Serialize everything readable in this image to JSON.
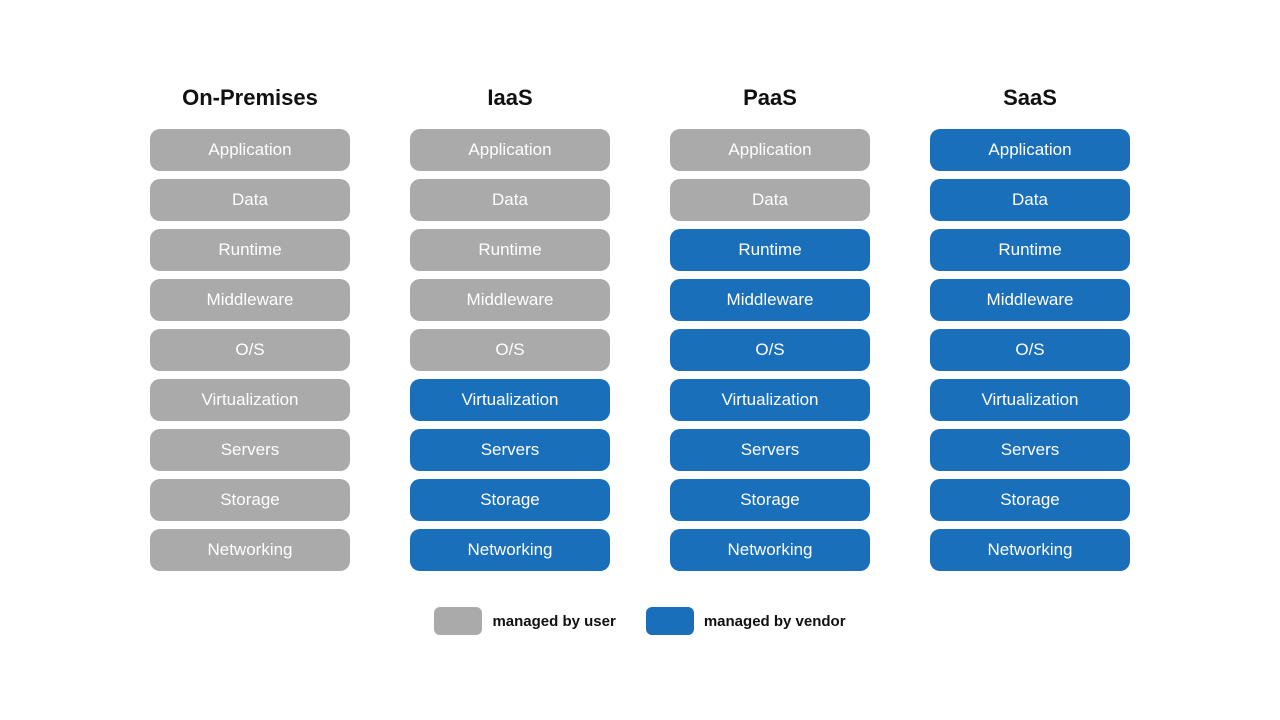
{
  "columns": [
    {
      "id": "on-premises",
      "header": "On-Premises",
      "pills": [
        {
          "label": "Application",
          "type": "user"
        },
        {
          "label": "Data",
          "type": "user"
        },
        {
          "label": "Runtime",
          "type": "user"
        },
        {
          "label": "Middleware",
          "type": "user"
        },
        {
          "label": "O/S",
          "type": "user"
        },
        {
          "label": "Virtualization",
          "type": "user"
        },
        {
          "label": "Servers",
          "type": "user"
        },
        {
          "label": "Storage",
          "type": "user"
        },
        {
          "label": "Networking",
          "type": "user"
        }
      ]
    },
    {
      "id": "iaas",
      "header": "IaaS",
      "pills": [
        {
          "label": "Application",
          "type": "user"
        },
        {
          "label": "Data",
          "type": "user"
        },
        {
          "label": "Runtime",
          "type": "user"
        },
        {
          "label": "Middleware",
          "type": "user"
        },
        {
          "label": "O/S",
          "type": "user"
        },
        {
          "label": "Virtualization",
          "type": "vendor"
        },
        {
          "label": "Servers",
          "type": "vendor"
        },
        {
          "label": "Storage",
          "type": "vendor"
        },
        {
          "label": "Networking",
          "type": "vendor"
        }
      ]
    },
    {
      "id": "paas",
      "header": "PaaS",
      "pills": [
        {
          "label": "Application",
          "type": "user"
        },
        {
          "label": "Data",
          "type": "user"
        },
        {
          "label": "Runtime",
          "type": "vendor"
        },
        {
          "label": "Middleware",
          "type": "vendor"
        },
        {
          "label": "O/S",
          "type": "vendor"
        },
        {
          "label": "Virtualization",
          "type": "vendor"
        },
        {
          "label": "Servers",
          "type": "vendor"
        },
        {
          "label": "Storage",
          "type": "vendor"
        },
        {
          "label": "Networking",
          "type": "vendor"
        }
      ]
    },
    {
      "id": "saas",
      "header": "SaaS",
      "pills": [
        {
          "label": "Application",
          "type": "vendor"
        },
        {
          "label": "Data",
          "type": "vendor"
        },
        {
          "label": "Runtime",
          "type": "vendor"
        },
        {
          "label": "Middleware",
          "type": "vendor"
        },
        {
          "label": "O/S",
          "type": "vendor"
        },
        {
          "label": "Virtualization",
          "type": "vendor"
        },
        {
          "label": "Servers",
          "type": "vendor"
        },
        {
          "label": "Storage",
          "type": "vendor"
        },
        {
          "label": "Networking",
          "type": "vendor"
        }
      ]
    }
  ],
  "legend": {
    "user_label": "managed by user",
    "vendor_label": "managed by vendor"
  }
}
